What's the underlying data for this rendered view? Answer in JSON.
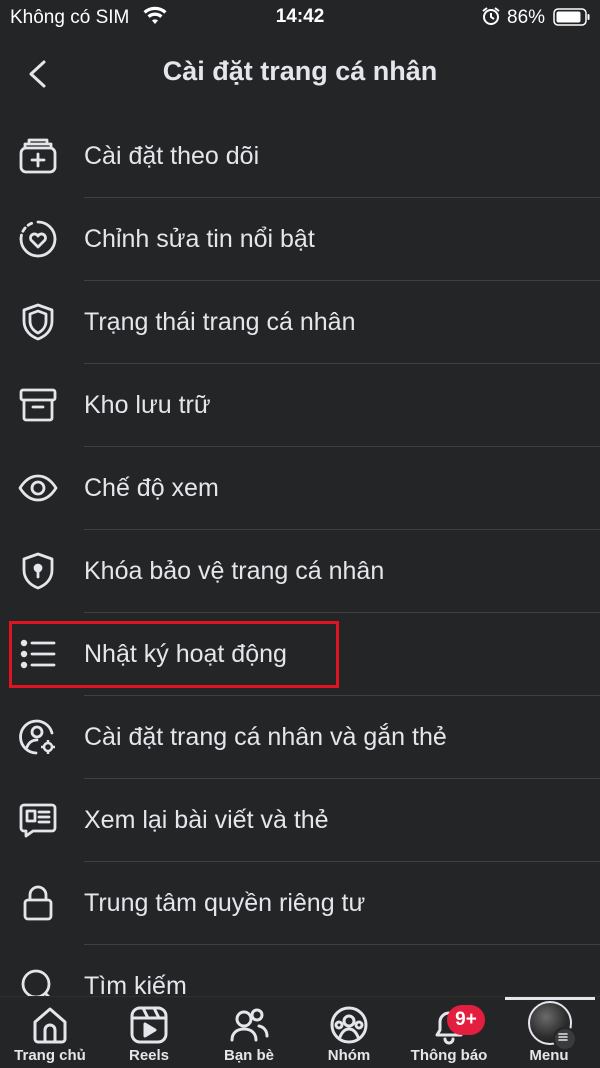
{
  "status_bar": {
    "carrier": "Không có SIM",
    "time": "14:42",
    "battery": "86%"
  },
  "header": {
    "title": "Cài đặt trang cá nhân",
    "back_icon": "chevron-left-icon"
  },
  "menu": {
    "items": [
      {
        "label": "Cài đặt theo dõi",
        "icon": "follow-settings-icon"
      },
      {
        "label": "Chỉnh sửa tin nổi bật",
        "icon": "story-highlight-icon"
      },
      {
        "label": "Trạng thái trang cá nhân",
        "icon": "shield-icon"
      },
      {
        "label": "Kho lưu trữ",
        "icon": "archive-icon"
      },
      {
        "label": "Chế độ xem",
        "icon": "eye-icon"
      },
      {
        "label": "Khóa bảo vệ trang cá nhân",
        "icon": "lock-shield-icon"
      },
      {
        "label": "Nhật ký hoạt động",
        "icon": "list-icon"
      },
      {
        "label": "Cài đặt trang cá nhân và gắn thẻ",
        "icon": "profile-gear-icon"
      },
      {
        "label": "Xem lại bài viết và thẻ",
        "icon": "review-posts-icon"
      },
      {
        "label": "Trung tâm quyền riêng tư",
        "icon": "padlock-icon"
      },
      {
        "label": "Tìm kiếm",
        "icon": "search-icon"
      }
    ]
  },
  "tab_bar": {
    "tabs": [
      {
        "label": "Trang chủ",
        "icon": "home-icon"
      },
      {
        "label": "Reels",
        "icon": "reels-icon"
      },
      {
        "label": "Bạn bè",
        "icon": "friends-icon"
      },
      {
        "label": "Nhóm",
        "icon": "groups-icon"
      },
      {
        "label": "Thông báo",
        "icon": "bell-icon"
      },
      {
        "label": "Menu",
        "icon": "avatar-menu-icon"
      }
    ],
    "notification_badge": "9+",
    "active_tab": "Menu"
  },
  "colors": {
    "background": "#242526",
    "text": "#e4e6eb",
    "divider": "#3e4042",
    "highlight_box": "#e0141e",
    "badge": "#e41e3f"
  }
}
